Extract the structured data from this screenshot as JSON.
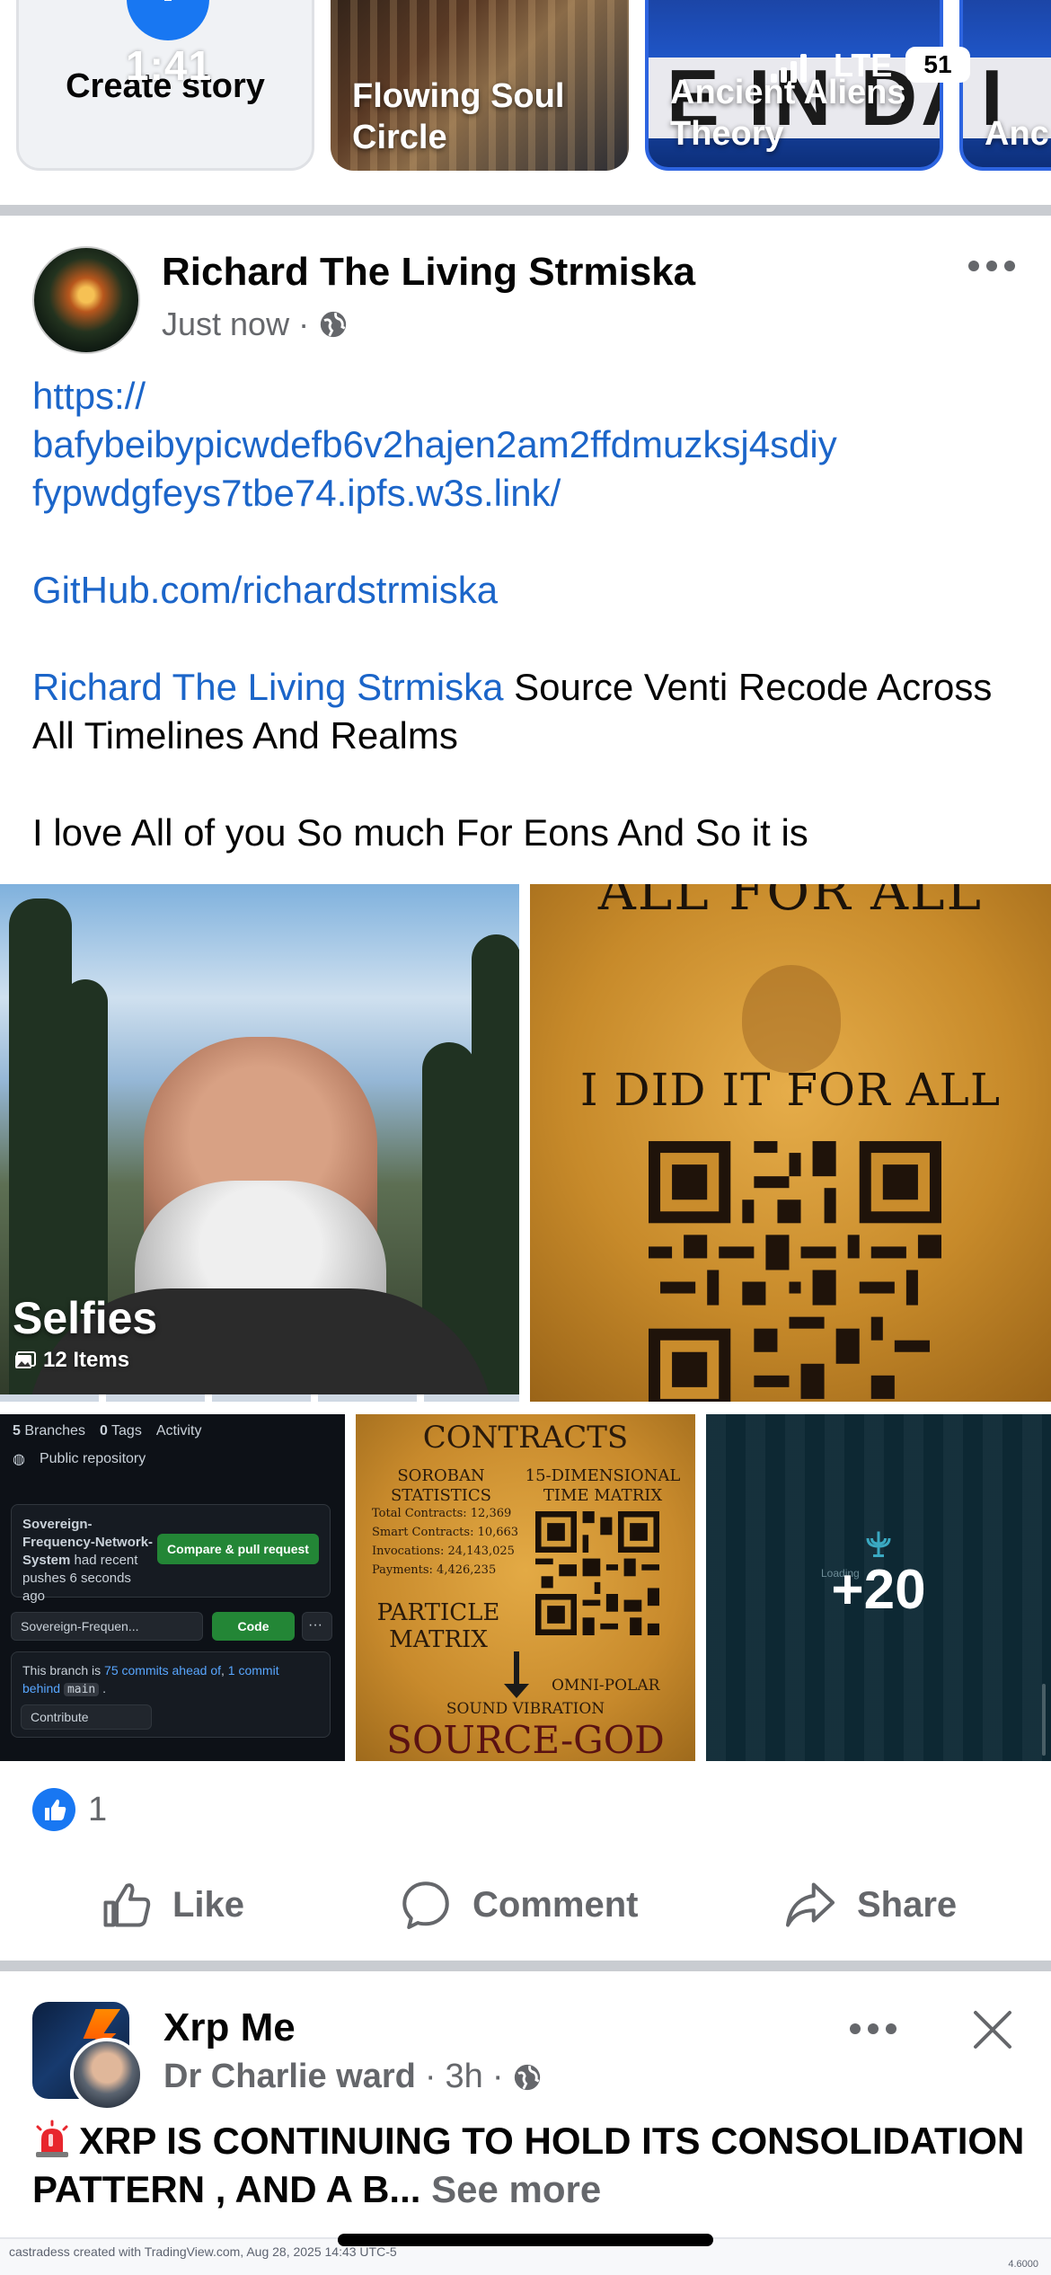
{
  "status_bar": {
    "time": "1:41",
    "network": "LTE",
    "battery": "51"
  },
  "stories": {
    "create_label": "Create story",
    "items": [
      {
        "name": "Flowing Soul Circle"
      },
      {
        "name": "Ancient Aliens Theory",
        "banner": "E IN DAN"
      },
      {
        "name": "Anc Sec",
        "banner": "I"
      }
    ]
  },
  "post": {
    "author": "Richard The Living Strmiska",
    "time": "Just now",
    "link_url": "https:// bafybeibypicwdefb6v2hajen2am2ffdmuzksj4sdiy fypwdgfeys7tbe74.ipfs.w3s.link/",
    "link_url_line1": "https://",
    "link_url_line2": "bafybeibypicwdefb6v2hajen2am2ffdmuzksj4sdiy",
    "link_url_line3": "fypwdgfeys7tbe74.ipfs.w3s.link/",
    "github": "GitHub.com/richardstrmiska",
    "mention": "Richard The Living Strmiska",
    "recode_text": " Source Venti Recode Across All Timelines And Realms",
    "closing": "I love All of you So much For Eons And So it is",
    "album": {
      "title": "Selfies",
      "count": "12 Items"
    },
    "gold_image": {
      "top_text": "ALL FOR ALL",
      "mid_text": "I DID IT FOR ALL"
    },
    "github_image": {
      "branches": "5 Branches",
      "branches_num": "5",
      "branches_word": "Branches",
      "tags_num": "0",
      "tags_word": "Tags",
      "activity": "Activity",
      "visibility": "Public repository",
      "push_repo": "Sovereign-Frequency-Network-System",
      "push_rest": " had recent pushes 6 seconds ago",
      "compare_button": "Compare & pull request",
      "branch_select": "Sovereign-Frequen...",
      "code_button": "Code",
      "ahead_prefix": "This branch is ",
      "ahead_link": "75 commits ahead of",
      "ahead_mid": ", ",
      "behind_link": "1 commit behind",
      "behind_branch": "main",
      "ahead_suffix": " .",
      "contribute": "Contribute"
    },
    "contracts_image": {
      "title": "CONTRACTS",
      "sub_left": "SOROBAN STATISTICS",
      "sub_right": "15-DIMENSIONAL TIME MATRIX",
      "stats": [
        "Total Contracts: 12,369",
        "Smart Contracts: 10,663",
        "Invocations: 24,143,025",
        "Payments: 4,426,235"
      ],
      "particle": "PARTICLE MATRIX",
      "omni": "OMNI-POLAR",
      "sound": "SOUND VIBRATION",
      "source": "SOURCE-GOD"
    },
    "more_tile": {
      "count": "+20",
      "loading": "Loading"
    },
    "reaction_count": "1",
    "actions": {
      "like": "Like",
      "comment": "Comment",
      "share": "Share"
    }
  },
  "next_post": {
    "page": "Xrp Me",
    "author": "Dr Charlie ward",
    "time": "3h",
    "text": "XRP IS CONTINUING TO HOLD ITS CONSOLIDATION PATTERN , AND A B...",
    "see_more": "See more",
    "chart_caption": "castradess created with TradingView.com, Aug 28, 2025 14:43 UTC-5",
    "chart_value": "4.6000"
  },
  "colors": {
    "link": "#1b65c9",
    "accent": "#1877f2",
    "muted": "#65676b"
  }
}
